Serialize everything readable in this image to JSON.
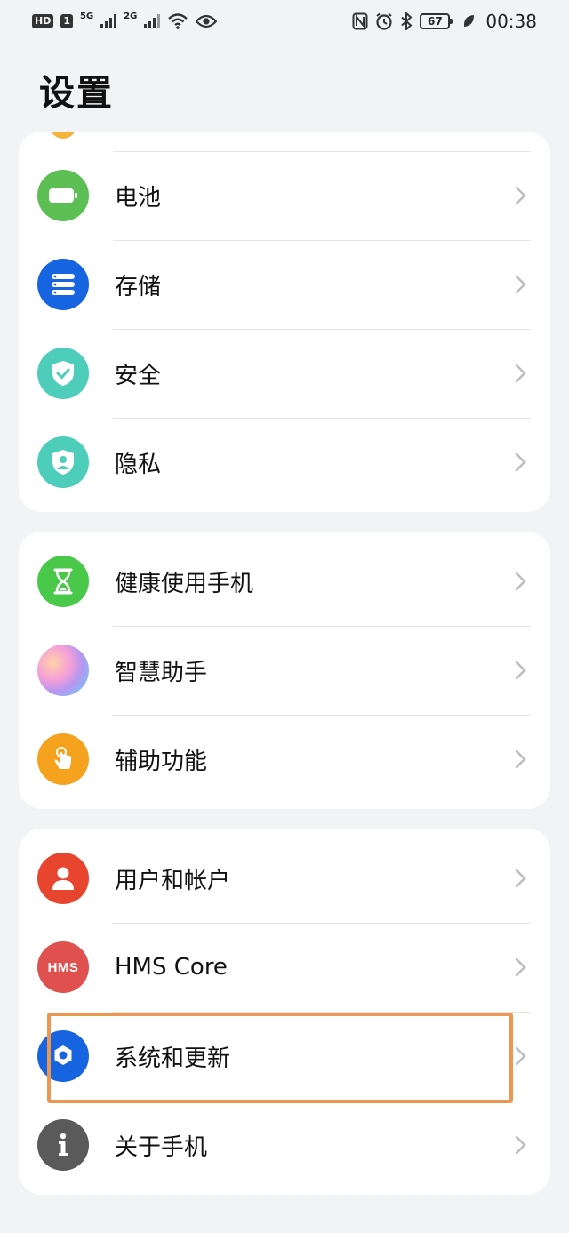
{
  "status_bar": {
    "hd": "HD",
    "sim": "1",
    "net1": "5G",
    "net2": "2G",
    "battery": "67",
    "time": "00:38"
  },
  "page_title": "设置",
  "groups": [
    {
      "items": [
        {
          "label": "电池",
          "icon": "battery-icon",
          "color": "#5cbf54"
        },
        {
          "label": "存储",
          "icon": "storage-icon",
          "color": "#1764e0"
        },
        {
          "label": "安全",
          "icon": "shield-icon",
          "color": "#4fcdbb"
        },
        {
          "label": "隐私",
          "icon": "privacy-icon",
          "color": "#4fcdbb"
        }
      ]
    },
    {
      "items": [
        {
          "label": "健康使用手机",
          "icon": "hourglass-icon",
          "color": "#4ac84a"
        },
        {
          "label": "智慧助手",
          "icon": "assistant-orb-icon",
          "color": "#e9a0e0"
        },
        {
          "label": "辅助功能",
          "icon": "hand-pointer-icon",
          "color": "#f5a21f"
        }
      ]
    },
    {
      "items": [
        {
          "label": "用户和帐户",
          "icon": "user-icon",
          "color": "#e8452f"
        },
        {
          "label": "HMS Core",
          "icon": "hms-core-icon",
          "color": "#e0504e",
          "icon_text": "HMS"
        },
        {
          "label": "系统和更新",
          "icon": "gear-icon",
          "color": "#1764e0"
        },
        {
          "label": "关于手机",
          "icon": "info-icon",
          "color": "#5a5a5a"
        }
      ]
    }
  ]
}
